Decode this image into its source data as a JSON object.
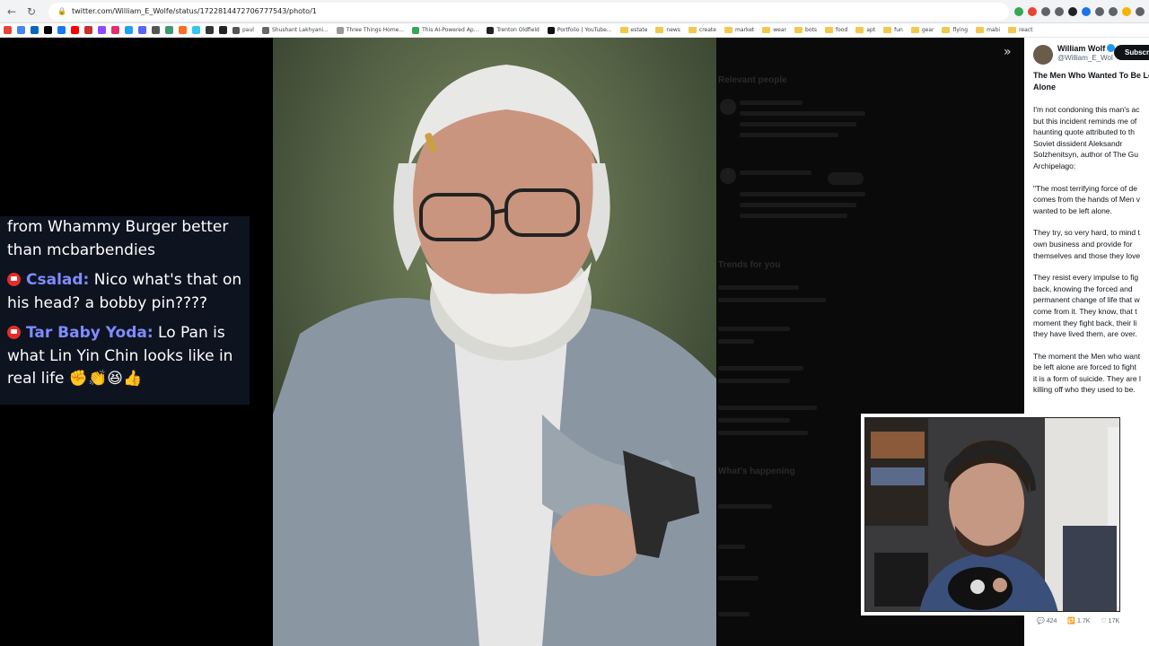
{
  "browser": {
    "url": "twitter.com/William_E_Wolfe/status/1722814472706777543/photo/1",
    "bookmarks": [
      {
        "label": "paul",
        "color": "#555555",
        "type": "site"
      },
      {
        "label": "Shushant Lakhyani...",
        "color": "#666666",
        "type": "site"
      },
      {
        "label": "Three Things Home...",
        "color": "#999999",
        "type": "site"
      },
      {
        "label": "This AI-Powered Ap...",
        "color": "#34a853",
        "type": "site"
      },
      {
        "label": "Trenton Oldfield",
        "color": "#222222",
        "type": "site"
      },
      {
        "label": "Portfolio | YouTube...",
        "color": "#111111",
        "type": "site"
      },
      {
        "label": "estate",
        "type": "folder"
      },
      {
        "label": "news",
        "type": "folder"
      },
      {
        "label": "create",
        "type": "folder"
      },
      {
        "label": "market",
        "type": "folder"
      },
      {
        "label": "wear",
        "type": "folder"
      },
      {
        "label": "bots",
        "type": "folder"
      },
      {
        "label": "food",
        "type": "folder"
      },
      {
        "label": "apt",
        "type": "folder"
      },
      {
        "label": "fun",
        "type": "folder"
      },
      {
        "label": "gear",
        "type": "folder"
      },
      {
        "label": "flying",
        "type": "folder"
      },
      {
        "label": "mabi",
        "type": "folder"
      },
      {
        "label": "react",
        "type": "folder"
      }
    ]
  },
  "chat": {
    "partial_text": "from Whammy Burger better than mcbarbendies",
    "messages": [
      {
        "user": "Csalad:",
        "text": " Nico what's that on his head? a bobby pin????"
      },
      {
        "user": "Tar Baby Yoda:",
        "text": " Lo Pan is what Lin Yin Chin looks like in real life ✊👏😆👍"
      }
    ]
  },
  "dimmed": {
    "relevant_people": "Relevant people",
    "trends": "Trends for you",
    "whats_happening": "What's happening"
  },
  "tweet": {
    "author_name": "William Wolf",
    "author_handle": "@William_E_Wol",
    "subscribe_label": "Subscri",
    "title": "The Men Who Wanted To Be Le Alone",
    "paragraphs": [
      [
        "I'm not condoning this man's ac",
        "but this incident reminds me of",
        "haunting quote attributed to th",
        "Soviet dissident Aleksandr",
        "Solzhenitsyn, author of The Gu",
        "Archipelago:"
      ],
      [
        "\"The most terrifying force of de",
        "comes from the hands of Men v",
        "wanted to be left alone."
      ],
      [
        "They try, so very hard, to mind t",
        "own business and provide for",
        "themselves and those they love"
      ],
      [
        "They resist every impulse to fig",
        "back, knowing the forced and",
        "permanent change of life that w",
        "come from it. They know, that t",
        "moment they fight back, their li",
        "they have lived them, are over."
      ],
      [
        "The moment the Men who want",
        "be left alone are forced to fight",
        "it is a form of suicide. They are l",
        "killing off who they used to be."
      ]
    ],
    "actions": {
      "replies": "424",
      "reposts": "1.7K",
      "likes": "17K"
    }
  }
}
